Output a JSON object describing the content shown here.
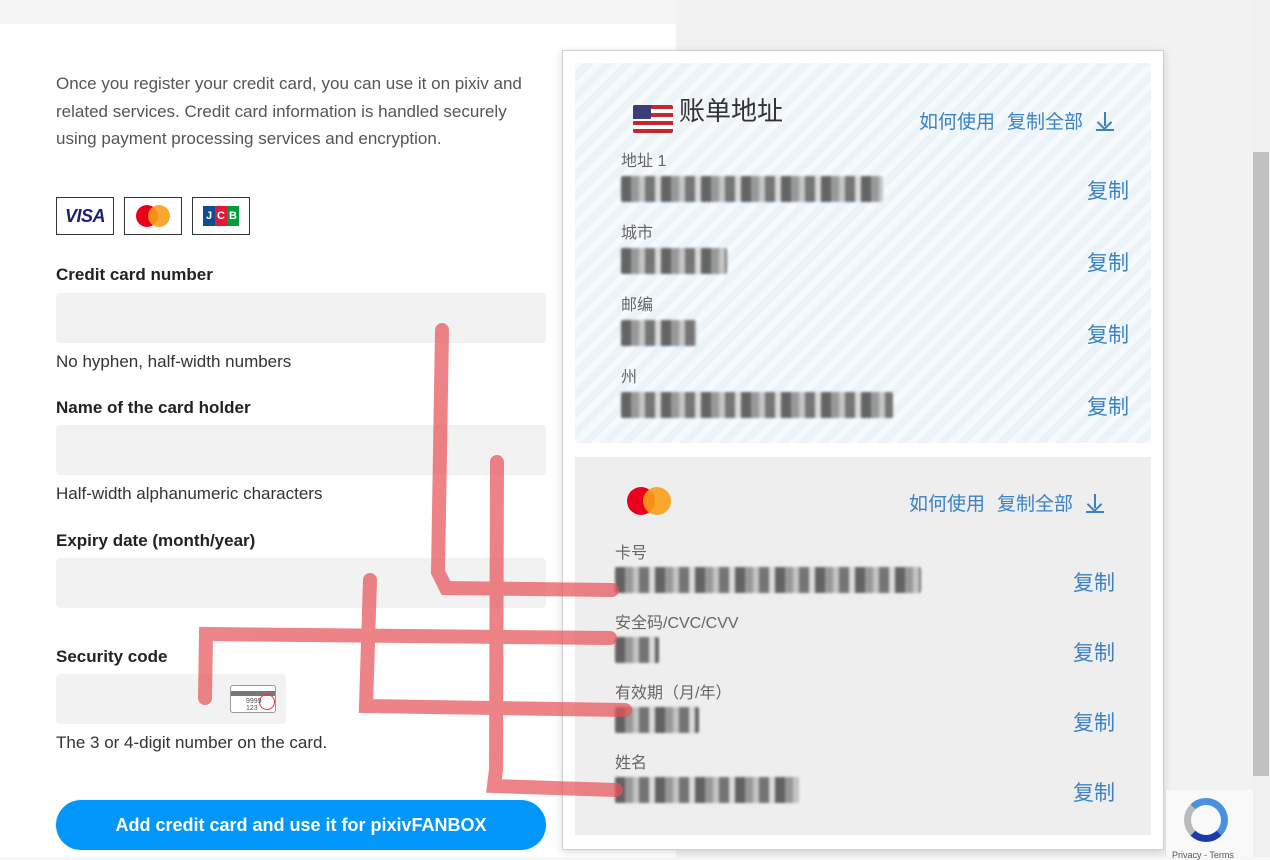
{
  "pixiv_form": {
    "intro": "Once you register your credit card, you can use it on pixiv and related services. Credit card information is handled securely using payment processing services and encryption.",
    "brands": [
      "VISA",
      "Mastercard",
      "JCB"
    ],
    "card_number_label": "Credit card number",
    "card_number_hint": "No hyphen, half-width numbers",
    "holder_label": "Name of the card holder",
    "holder_hint": "Half-width alphanumeric characters",
    "expiry_label": "Expiry date (month/year)",
    "security_label": "Security code",
    "security_hint": "The 3 or 4-digit number on the card.",
    "security_card_digits": "9999 123",
    "submit_label": "Add credit card and use it for pixivFANBOX"
  },
  "autofill": {
    "address_section": {
      "flag_icon": "us-flag-icon",
      "title": "账单地址",
      "how_to": "如何使用",
      "copy_all": "复制全部",
      "rows": [
        {
          "label": "地址 1",
          "copy": "复制"
        },
        {
          "label": "城市",
          "copy": "复制"
        },
        {
          "label": "邮编",
          "copy": "复制"
        },
        {
          "label": "州",
          "copy": "复制"
        }
      ]
    },
    "card_section": {
      "brand_icon": "mastercard-icon",
      "how_to": "如何使用",
      "copy_all": "复制全部",
      "rows": [
        {
          "label": "卡号",
          "copy": "复制"
        },
        {
          "label": "安全码/CVC/CVV",
          "copy": "复制"
        },
        {
          "label": "有效期（月/年）",
          "copy": "复制"
        },
        {
          "label": "姓名",
          "copy": "复制"
        }
      ]
    }
  },
  "recaptcha": {
    "privacy": "Privacy",
    "terms": "Terms"
  },
  "colors": {
    "accent": "#0096fa",
    "link": "#3b82c4",
    "annotation": "#e8545a"
  }
}
